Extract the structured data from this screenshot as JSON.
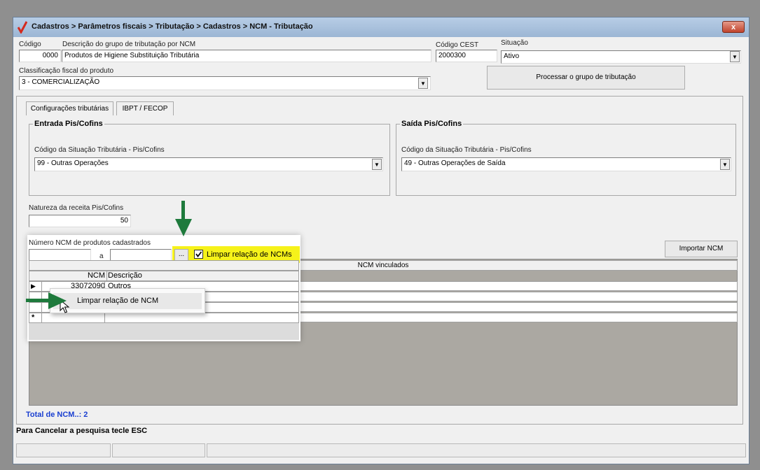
{
  "window": {
    "title": "Cadastros > Parâmetros fiscais > Tributação > Cadastros > NCM - Tributação",
    "close_label": "x"
  },
  "form": {
    "codigo_label": "Código",
    "codigo_value": "0000",
    "descricao_label": "Descrição do grupo de tributação por NCM",
    "descricao_value": "Produtos de Higiene Substituição Tributária",
    "cest_label": "Código CEST",
    "cest_value": "2000300",
    "situacao_label": "Situação",
    "situacao_value": "Ativo",
    "classificacao_label": "Classificação fiscal do produto",
    "classificacao_value": "3 - COMERCIALIZAÇÃO",
    "processar_button": "Processar o grupo de tributação"
  },
  "tabs": [
    {
      "label": "Configurações tributárias"
    },
    {
      "label": "IBPT / FECOP"
    }
  ],
  "entrada": {
    "title": "Entrada Pis/Cofins",
    "cst_label": "Código da Situação Tributária - Pis/Cofins",
    "cst_value": "99 -  Outras Operações"
  },
  "saida": {
    "title": "Saída Pis/Cofins",
    "cst_label": "Código da Situação Tributária - Pis/Cofins",
    "cst_value": "49 -  Outras Operações de Saída"
  },
  "natureza": {
    "label": "Natureza da receita Pis/Cofins",
    "value": "50"
  },
  "ncm_filter": {
    "label": "Número  NCM de produtos cadastrados",
    "from_value": "",
    "separator": "a",
    "to_value": "",
    "ellipsis_button": "...",
    "checkbox_label": "Limpar relação de NCMs",
    "checkbox_checked": true,
    "importar_button": "Importar NCM"
  },
  "grid": {
    "title": "NCM vinculados",
    "columns": [
      "NCM",
      "Descrição"
    ],
    "rows": [
      {
        "ncm": "33072090",
        "descricao": "Outros"
      }
    ],
    "new_row_marker": "*",
    "current_row_marker": "▶"
  },
  "context_menu": {
    "items": [
      {
        "label": "Limpar relação de NCM"
      }
    ]
  },
  "footer": {
    "total_label": "Total de NCM..: 2",
    "hint": "Para Cancelar a pesquisa tecle ESC"
  },
  "colors": {
    "arrow": "#1e7a3c",
    "highlight": "#f6f21a",
    "total_text": "#1a3fd0"
  }
}
